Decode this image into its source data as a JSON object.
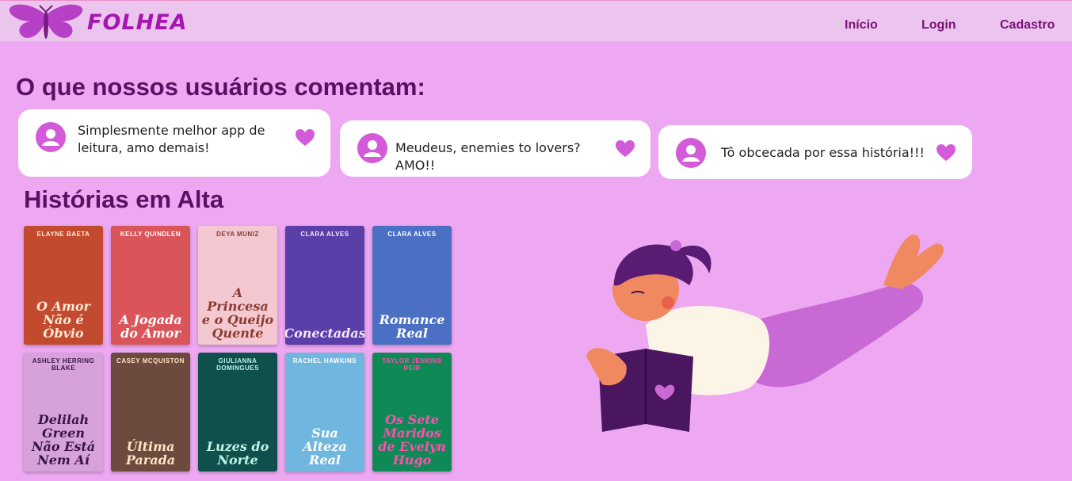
{
  "brand": {
    "name": "FOLHEA",
    "color": "#a516b0"
  },
  "nav": {
    "inicio": "Início",
    "login": "Login",
    "cadastro": "Cadastro"
  },
  "comments": {
    "title": "O que nossos usuários comentam:",
    "items": [
      {
        "text": "Simplesmente melhor app de leitura, amo demais!"
      },
      {
        "text": "Meudeus, enemies to lovers? AMO!!"
      },
      {
        "text": "Tô obcecada por essa história!!!"
      }
    ]
  },
  "trending": {
    "title": "Histórias em Alta",
    "books": [
      {
        "title": "O Amor Não é Óbvio",
        "author": "Elayne Baeta",
        "bg": "#c24a2e",
        "fg": "#ffe9d6"
      },
      {
        "title": "A Jogada do Amor",
        "author": "Kelly Quindlen",
        "bg": "#d9555a",
        "fg": "#ffffff"
      },
      {
        "title": "A Princesa e o Queijo Quente",
        "author": "Deya Muniz",
        "bg": "#f3c8d0",
        "fg": "#8b3b2f"
      },
      {
        "title": "Conectadas",
        "author": "Clara Alves",
        "bg": "#5b3fa8",
        "fg": "#f6e7ff"
      },
      {
        "title": "Romance Real",
        "author": "Clara Alves",
        "bg": "#4b6fc2",
        "fg": "#ffffff"
      },
      {
        "title": "Delilah Green Não Está Nem Aí",
        "author": "Ashley Herring Blake",
        "bg": "#d6a2d9",
        "fg": "#3b1446"
      },
      {
        "title": "Última Parada",
        "author": "Casey McQuiston",
        "bg": "#6d4a3e",
        "fg": "#ffe3c4"
      },
      {
        "title": "Luzes do Norte",
        "author": "Giulianna Domingues",
        "bg": "#0f4f4c",
        "fg": "#bff3e6"
      },
      {
        "title": "Sua Alteza Real",
        "author": "Rachel Hawkins",
        "bg": "#6fb7de",
        "fg": "#ffffff"
      },
      {
        "title": "Os Sete Maridos de Evelyn Hugo",
        "author": "Taylor Jenkins Reid",
        "bg": "#0f8a56",
        "fg": "#ff4fae"
      }
    ]
  },
  "icons": {
    "logo": "butterfly-icon",
    "avatar": "user-avatar-icon",
    "heart": "heart-icon"
  },
  "colors": {
    "accent": "#c443d4",
    "heading": "#5b0f63",
    "page": "#eea8f2"
  }
}
